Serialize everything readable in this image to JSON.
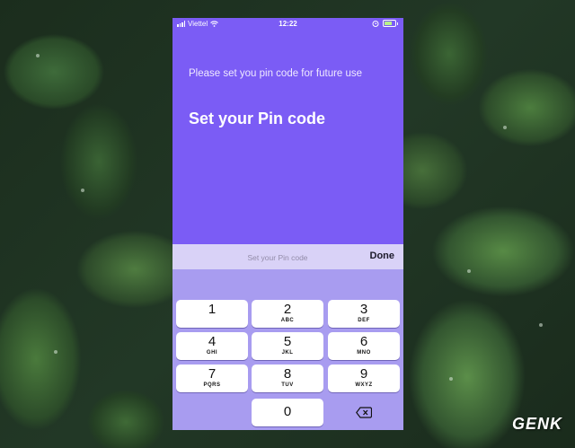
{
  "status_bar": {
    "carrier": "Viettel",
    "time": "12:22"
  },
  "screen": {
    "subtitle": "Please set you pin code for future use",
    "title": "Set your Pin code"
  },
  "pin_input": {
    "placeholder": "Set your Pin code",
    "value": ""
  },
  "done_label": "Done",
  "keypad": {
    "keys": [
      {
        "digit": "1",
        "letters": ""
      },
      {
        "digit": "2",
        "letters": "ABC"
      },
      {
        "digit": "3",
        "letters": "DEF"
      },
      {
        "digit": "4",
        "letters": "GHI"
      },
      {
        "digit": "5",
        "letters": "JKL"
      },
      {
        "digit": "6",
        "letters": "MNO"
      },
      {
        "digit": "7",
        "letters": "PQRS"
      },
      {
        "digit": "8",
        "letters": "TUV"
      },
      {
        "digit": "9",
        "letters": "WXYZ"
      },
      {
        "digit": "0",
        "letters": ""
      }
    ],
    "delete_icon": "backspace-icon"
  },
  "watermark": "GENK",
  "colors": {
    "accent": "#7b5cf5",
    "keypad_bg": "#a89cf0",
    "input_bar": "#d9d2f7"
  }
}
